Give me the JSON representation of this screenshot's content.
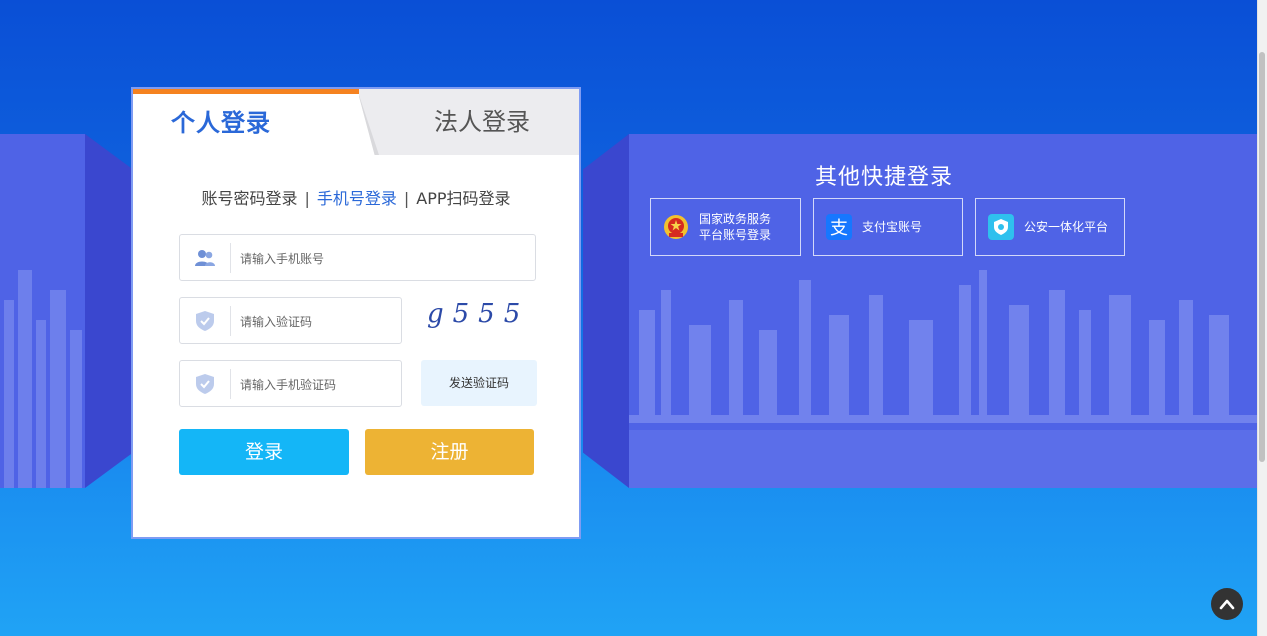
{
  "tabs": {
    "personal": "个人登录",
    "legal": "法人登录"
  },
  "methods": {
    "account": "账号密码登录",
    "phone": "手机号登录",
    "app": "APP扫码登录",
    "separator": "|"
  },
  "fields": {
    "phone_placeholder": "请输入手机账号",
    "captcha_placeholder": "请输入验证码",
    "sms_placeholder": "请输入手机验证码"
  },
  "captcha_text": "g555",
  "send_code": "发送验证码",
  "buttons": {
    "login": "登录",
    "register": "注册"
  },
  "other": {
    "title": "其他快捷登录",
    "gov_line1": "国家政务服务",
    "gov_line2": "平台账号登录",
    "alipay": "支付宝账号",
    "police": "公安一体化平台"
  },
  "colors": {
    "accent": "#2a68d8",
    "tab_top": "#f58220",
    "login_btn": "#14b6f7",
    "register_btn": "#edb334"
  },
  "icons": [
    "user-icon",
    "shield-check-icon",
    "national-emblem-icon",
    "alipay-icon",
    "police-badge-icon",
    "arrow-up-icon"
  ]
}
